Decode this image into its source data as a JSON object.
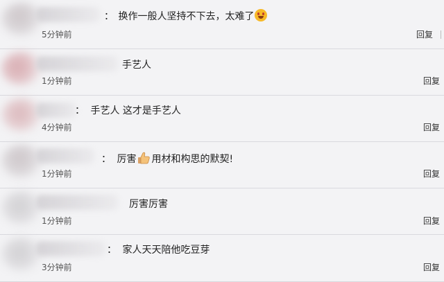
{
  "comments": [
    {
      "separator": "：",
      "text": "换作一般人坚持不下去，太难了",
      "emoji": "grinning-face-icon",
      "time": "5分钟前",
      "reply": "回复"
    },
    {
      "separator": "：",
      "text": "手艺人",
      "time": "1分钟前",
      "reply": "回复"
    },
    {
      "separator": "：",
      "text": "手艺人 这才是手艺人",
      "time": "4分钟前",
      "reply": "回复"
    },
    {
      "separator": "：",
      "text_before": "厉害",
      "emoji": "thumbs-up-icon",
      "text_after": "用材和构思的默契!",
      "time": "1分钟前",
      "reply": "回复"
    },
    {
      "separator": "：",
      "text": "厉害厉害",
      "time": "1分钟前",
      "reply": "回复"
    },
    {
      "separator": "：",
      "text": "家人天天陪他吃豆芽",
      "time": "3分钟前",
      "reply": "回复"
    }
  ]
}
